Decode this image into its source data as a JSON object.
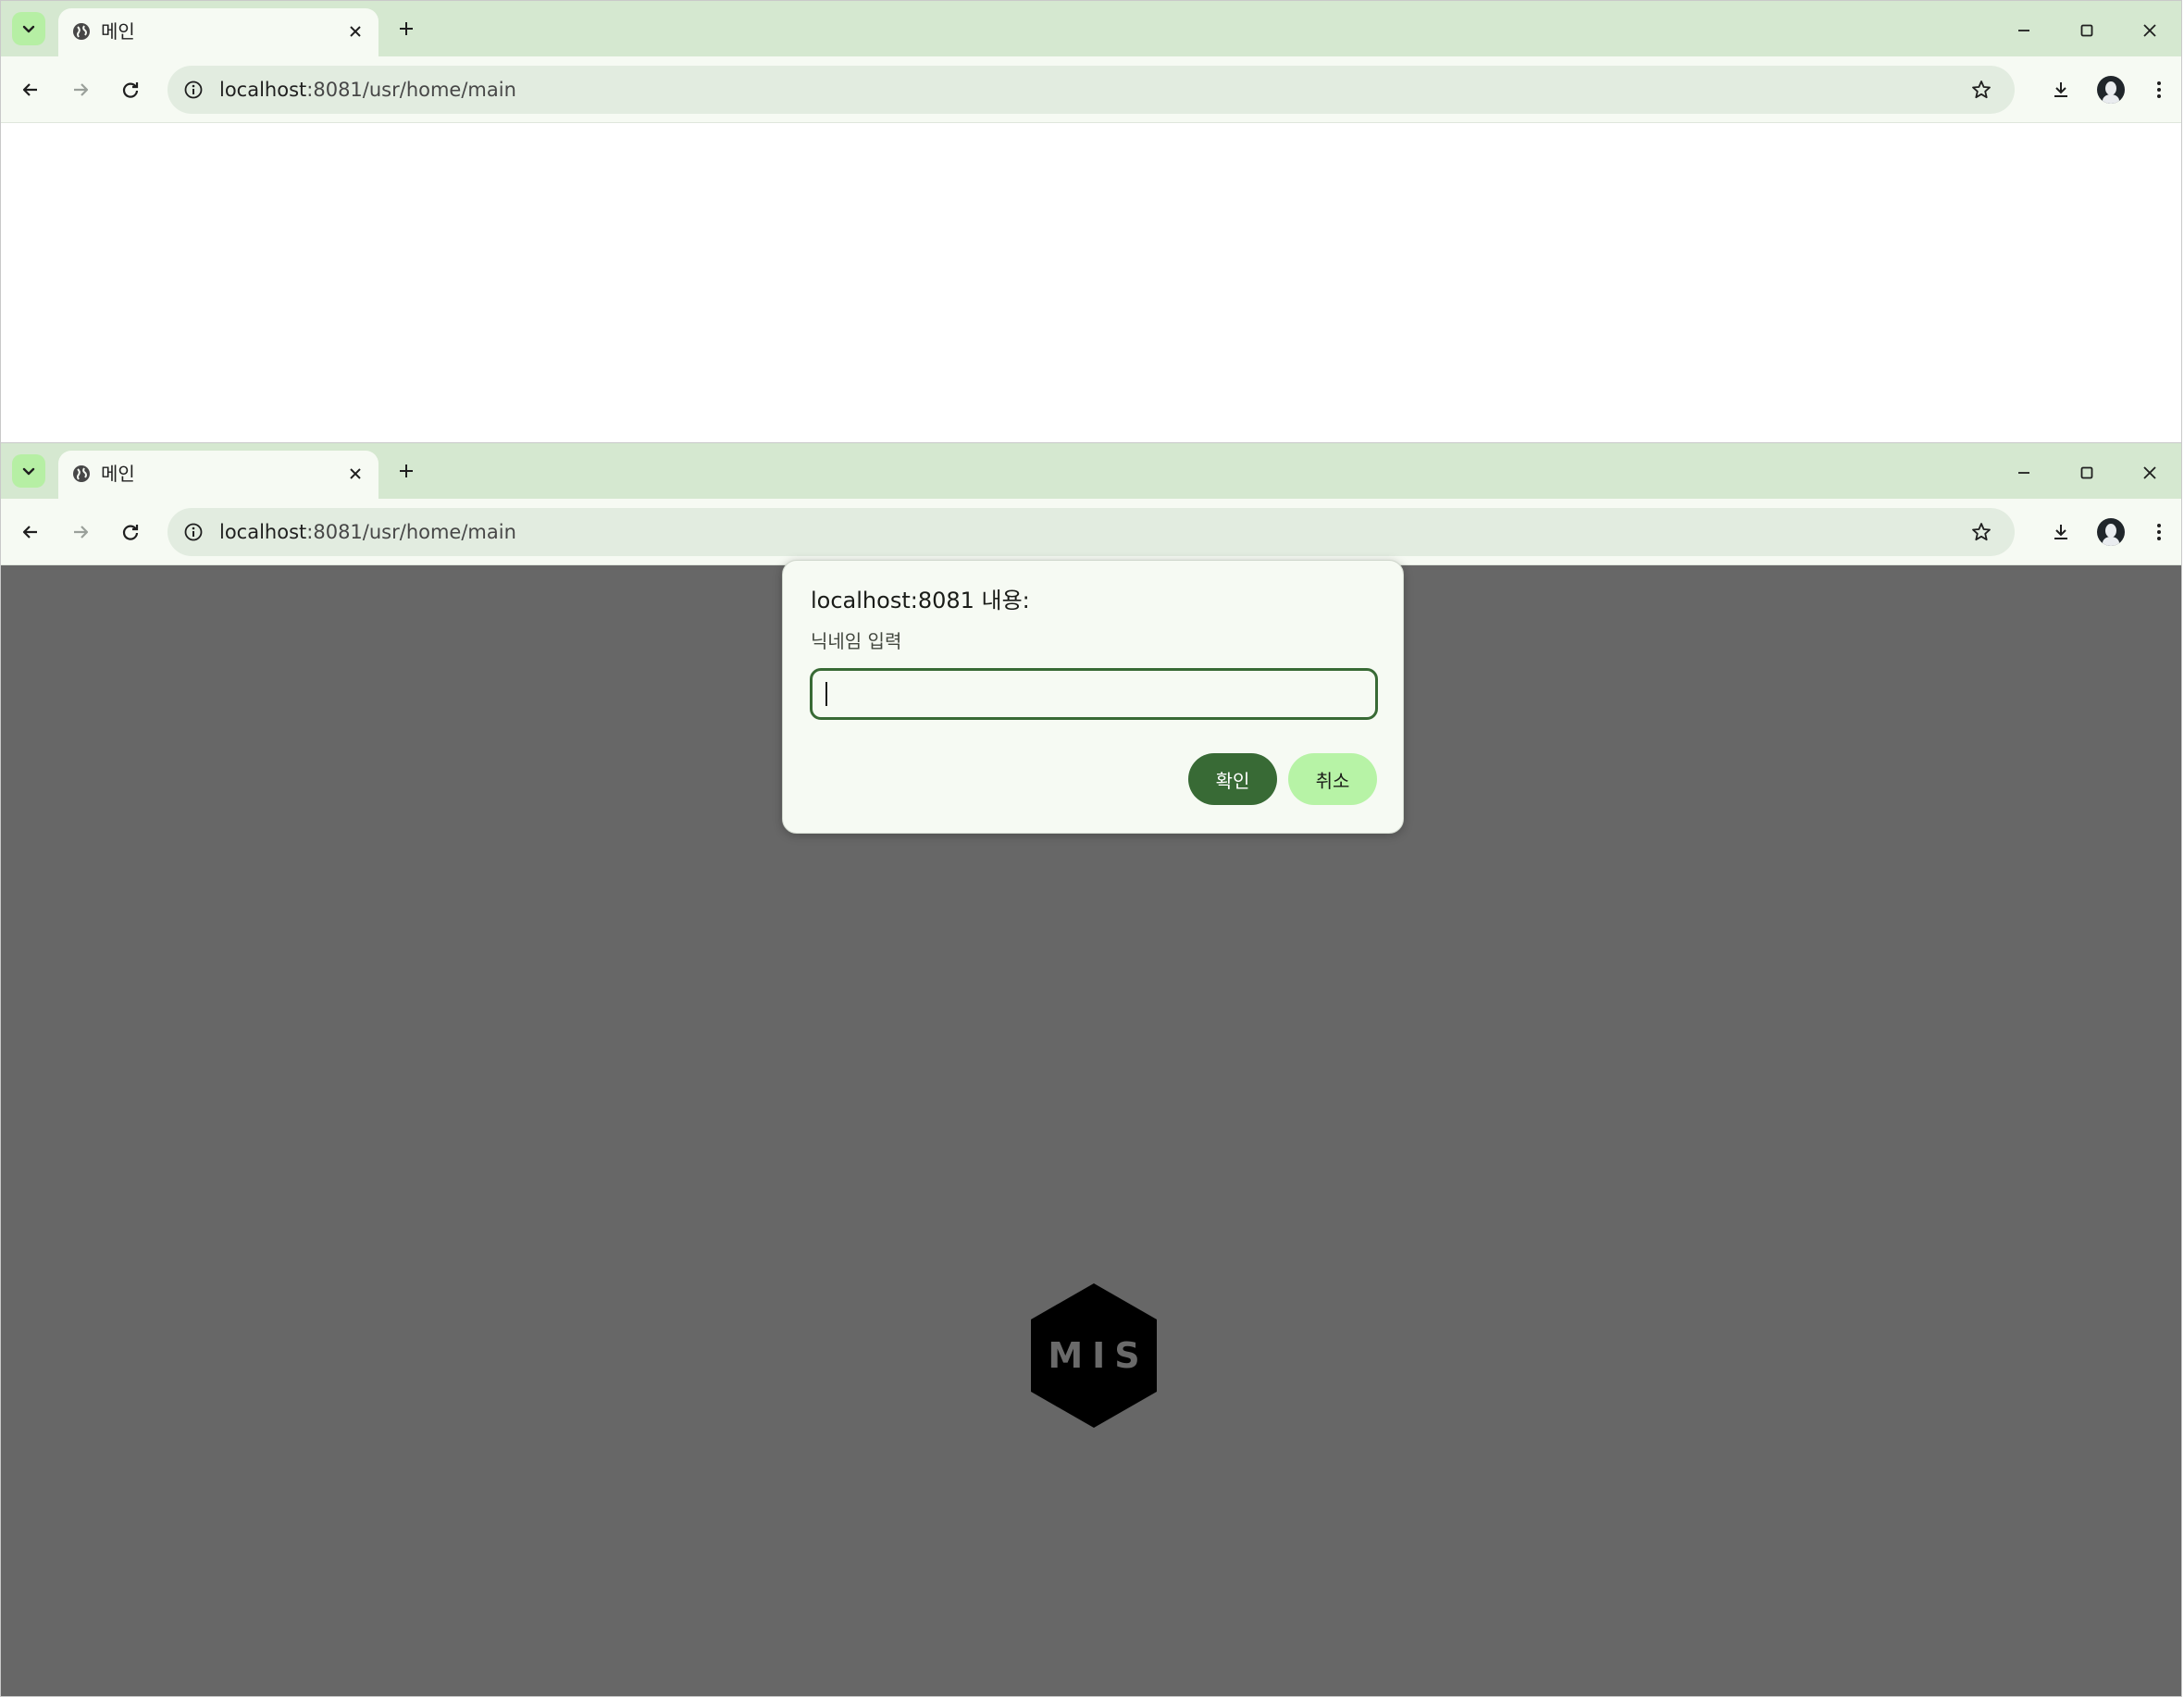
{
  "windows": [
    {
      "tab": {
        "title": "메인"
      },
      "address": {
        "host": "localhost",
        "path": ":8081/usr/home/main"
      }
    },
    {
      "tab": {
        "title": "메인"
      },
      "address": {
        "host": "localhost",
        "path": ":8081/usr/home/main"
      },
      "logo": {
        "text": "MIS"
      },
      "dialog": {
        "title": "localhost:8081 내용:",
        "message": "닉네임 입력",
        "input_value": "",
        "ok_label": "확인",
        "cancel_label": "취소"
      }
    }
  ],
  "colors": {
    "tabstrip": "#d5e8d0",
    "toolbar": "#f6faf3",
    "overlay": "#676767",
    "accent": "#386a35",
    "cancel_button": "#b7f3a6"
  },
  "icons": [
    "chevron-down-icon",
    "globe-icon",
    "close-icon",
    "plus-icon",
    "minimize-icon",
    "maximize-icon",
    "arrow-left-icon",
    "arrow-right-icon",
    "reload-icon",
    "info-icon",
    "star-icon",
    "download-icon",
    "avatar",
    "kebab-menu-icon",
    "hexagon-logo"
  ]
}
